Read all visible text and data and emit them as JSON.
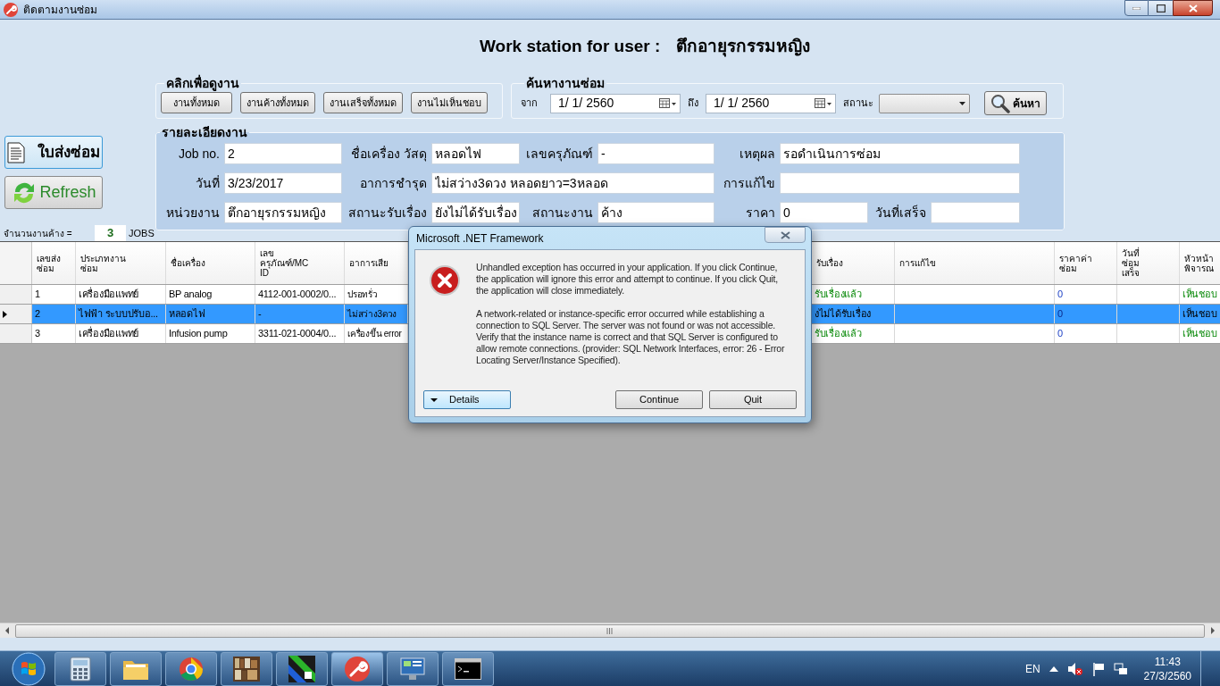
{
  "window": {
    "title": "ติดตามงานซ่อม"
  },
  "header": {
    "label": "Work station for user :",
    "user": "ตึกอายุรกรรมหญิง"
  },
  "view_group": {
    "title": "คลิกเพื่อดูงาน",
    "buttons": [
      "งานทั้งหมด",
      "งานค้างทั้งหมด",
      "งานเสร็จทั้งหมด",
      "งานไม่เห็นชอบ"
    ]
  },
  "search": {
    "title": "ค้นหางานซ่อม",
    "from_label": "จาก",
    "from_value": "1/ 1/ 2560",
    "to_label": "ถึง",
    "to_value": "1/ 1/ 2560",
    "status_label": "สถานะ",
    "button": "ค้นหา"
  },
  "actions": [
    {
      "label": "ใบส่งซ่อม",
      "kind": "document"
    },
    {
      "label": "Refresh",
      "kind": "refresh"
    }
  ],
  "pending": {
    "label": "จำนวนงานค้าง =",
    "count": "3",
    "unit": "JOBS"
  },
  "details": {
    "title": "รายละเอียดงาน",
    "fields": [
      {
        "label": "Job no.",
        "value": "2"
      },
      {
        "label": "ชื่อเครื่อง วัสดุ",
        "value": "หลอดไฟ"
      },
      {
        "label": "เลขครุภัณฑ์",
        "value": "-"
      },
      {
        "label": "เหตุผล",
        "value": "รอดำเนินการซ่อม"
      },
      {
        "label": "วันที่",
        "value": "3/23/2017"
      },
      {
        "label": "อาการชำรุด",
        "value": "ไม่สว่าง3ดวง หลอดยาว=3หลอด"
      },
      {
        "label": "การแก้ไข"
      },
      {
        "label": "หน่วยงาน",
        "value": "ตึกอายุรกรรมหญิง"
      },
      {
        "label": "สถานะรับเรื่อง",
        "value": "ยังไม่ได้รับเรื่อง"
      },
      {
        "label": "สถานะงาน",
        "value": "ค้าง"
      },
      {
        "label": "ราคา",
        "value": "0"
      },
      {
        "label": "วันที่เสร็จ"
      }
    ]
  },
  "table": {
    "columns": [
      {
        "label": "เลขส่ง\nซ่อม",
        "kind": "text"
      },
      {
        "label": "ประเภทงาน\nซ่อม",
        "kind": "text"
      },
      {
        "label": "ชื่อเครื่อง",
        "kind": "text"
      },
      {
        "label": "เลข\nครุภัณฑ์/MC\nID",
        "kind": "text"
      },
      {
        "label": "อาการเสีย",
        "kind": "text"
      },
      {
        "label": "รับเรื่อง",
        "kind": "status"
      },
      {
        "label": "การแก้ไข",
        "kind": "text"
      },
      {
        "label": "ราคาค่า\nซ่อม",
        "kind": "price"
      },
      {
        "label": "วันที่\nซ่อม\nเสร็จ",
        "kind": "text"
      },
      {
        "label": "หัวหน้า\nพิจารณ",
        "kind": "status"
      }
    ],
    "rows": [
      {
        "selected": false,
        "cells": [
          "1",
          "เครื่องมือแพทย์",
          "BP analog",
          "4112-001-0002/0...",
          "ปรอทรั่ว",
          "รับเรื่องแล้ว",
          null,
          "0",
          null,
          "เห็นชอบ"
        ]
      },
      {
        "selected": true,
        "cells": [
          "2",
          "ไฟฟ้า ระบบปรับอ...",
          "หลอดไฟ",
          "-",
          "ไม่สว่าง3ดวง",
          "งไม่ได้รับเรื่อง",
          null,
          "0",
          null,
          "เห็นชอบ"
        ]
      },
      {
        "selected": false,
        "cells": [
          "3",
          "เครื่องมือแพทย์",
          "Infusion pump",
          "3311-021-0004/0...",
          "เครื่องขึ้น error",
          "รับเรื่องแล้ว",
          null,
          "0",
          null,
          "เห็นชอบ"
        ]
      }
    ]
  },
  "dialog": {
    "title": "Microsoft .NET Framework",
    "paragraphs": [
      "Unhandled exception has occurred in your application. If you click Continue, the application will ignore this error and attempt to continue. If you click Quit, the application will close immediately.",
      "A network-related or instance-specific error occurred while establishing a connection to SQL Server. The server was not found or was not accessible. Verify that the instance name is correct and that SQL Server is configured to allow remote connections. (provider: SQL Network Interfaces, error: 26 - Error Locating Server/Instance Specified)."
    ],
    "details_button": "Details",
    "buttons": [
      "Continue",
      "Quit"
    ]
  },
  "taskbar": {
    "apps": [
      {
        "kind": "calculator"
      },
      {
        "kind": "folder"
      },
      {
        "kind": "browser"
      },
      {
        "kind": "books"
      },
      {
        "kind": "diagonal"
      },
      {
        "kind": "wrench"
      },
      {
        "kind": "monitor"
      },
      {
        "kind": "terminal"
      }
    ],
    "language": "EN",
    "time": "11:43",
    "date": "27/3/2560"
  }
}
